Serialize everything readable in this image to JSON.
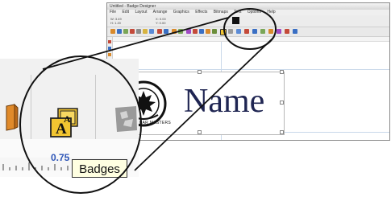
{
  "app_window": {
    "title": "Untitled - Badge Designer",
    "menus": [
      "File",
      "Edit",
      "Layout",
      "Arrange",
      "Graphics",
      "Effects",
      "Bitmaps",
      "Text",
      "Options",
      "Help"
    ],
    "props": [
      "W: 3.49",
      "H: 1.20",
      "X: 0.00",
      "Y: 0.00"
    ]
  },
  "badge_preview": {
    "name_text": "Name",
    "logo_text": "JAGUAR MASTERS"
  },
  "zoom": {
    "ruler_value": "0.75",
    "tooltip_label": "Badges"
  },
  "colors": {
    "badges_icon_fill": "#f2c531",
    "accent_blue": "#2d55b7",
    "name_text": "#1f2552"
  }
}
